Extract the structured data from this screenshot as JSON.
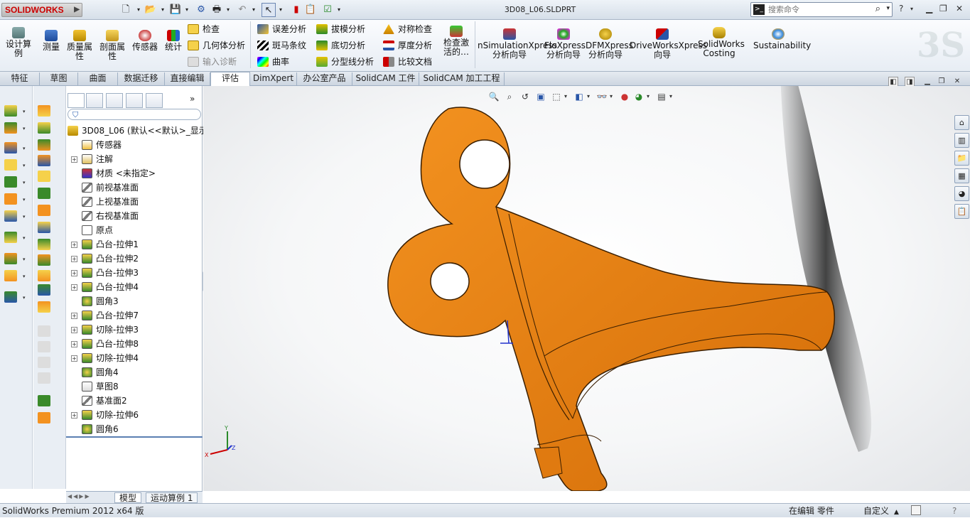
{
  "titlebar": {
    "app_logo": "SOLIDWORKS",
    "document_title": "3D08_L06.SLDPRT",
    "search_placeholder": "搜索命令",
    "help_label": "?"
  },
  "ribbon": {
    "big_buttons": [
      {
        "label": "设计算例",
        "icon": "design-study-icon"
      },
      {
        "label": "测量",
        "icon": "measure-icon"
      },
      {
        "label": "质量属性",
        "icon": "mass-properties-icon"
      },
      {
        "label": "剖面属性",
        "icon": "section-properties-icon"
      },
      {
        "label": "传感器",
        "icon": "sensor-icon"
      },
      {
        "label": "统计",
        "icon": "statistics-icon"
      }
    ],
    "col1": [
      {
        "label": "检查",
        "icon": "check-icon"
      },
      {
        "label": "几何体分析",
        "icon": "geometry-analysis-icon"
      },
      {
        "label": "输入诊断",
        "icon": "import-diagnostics-icon"
      }
    ],
    "col2": [
      {
        "label": "误差分析",
        "icon": "deviation-analysis-icon"
      },
      {
        "label": "斑马条纹",
        "icon": "zebra-stripes-icon"
      },
      {
        "label": "曲率",
        "icon": "curvature-icon"
      }
    ],
    "col3": [
      {
        "label": "拔模分析",
        "icon": "draft-analysis-icon"
      },
      {
        "label": "底切分析",
        "icon": "undercut-analysis-icon"
      },
      {
        "label": "分型线分析",
        "icon": "parting-line-analysis-icon"
      }
    ],
    "col4": [
      {
        "label": "对称检查",
        "icon": "symmetry-check-icon"
      },
      {
        "label": "厚度分析",
        "icon": "thickness-analysis-icon"
      },
      {
        "label": "比较文档",
        "icon": "compare-documents-icon"
      }
    ],
    "check_active": "检查激活的…",
    "xpress": [
      {
        "label": "nSimulationXpress 分析向导",
        "icon": "simulationxpress-icon"
      },
      {
        "label": "FloXpress 分析向导",
        "icon": "floxpress-icon"
      },
      {
        "label": "DFMXpress 分析向导",
        "icon": "dfmxpress-icon"
      },
      {
        "label": "DriveWorksXpress 向导",
        "icon": "driveworksxpress-icon"
      },
      {
        "label": "SolidWorks Costing",
        "icon": "costing-icon"
      },
      {
        "label": "Sustainability",
        "icon": "sustainability-icon"
      }
    ]
  },
  "tabs": [
    "特征",
    "草图",
    "曲面",
    "数据迁移",
    "直接编辑",
    "评估",
    "DimXpert",
    "办公室产品",
    "SolidCAM 工件",
    "SolidCAM 加工工程"
  ],
  "active_tab": "评估",
  "feature_tree": {
    "root": "3D08_L06  (默认<<默认>_显示",
    "items": [
      {
        "label": "传感器",
        "icon": "sensor-folder-icon",
        "expand": false
      },
      {
        "label": "注解",
        "icon": "annotations-icon",
        "expand": true
      },
      {
        "label": "材质 <未指定>",
        "icon": "material-icon",
        "expand": false
      },
      {
        "label": "前视基准面",
        "icon": "plane-icon",
        "expand": false
      },
      {
        "label": "上视基准面",
        "icon": "plane-icon",
        "expand": false
      },
      {
        "label": "右视基准面",
        "icon": "plane-icon",
        "expand": false
      },
      {
        "label": "原点",
        "icon": "origin-icon",
        "expand": false
      },
      {
        "label": "凸台-拉伸1",
        "icon": "boss-extrude-icon",
        "expand": true
      },
      {
        "label": "凸台-拉伸2",
        "icon": "boss-extrude-icon",
        "expand": true
      },
      {
        "label": "凸台-拉伸3",
        "icon": "boss-extrude-icon",
        "expand": true
      },
      {
        "label": "凸台-拉伸4",
        "icon": "boss-extrude-icon",
        "expand": true
      },
      {
        "label": "圆角3",
        "icon": "fillet-icon",
        "expand": false
      },
      {
        "label": "凸台-拉伸7",
        "icon": "boss-extrude-icon",
        "expand": true
      },
      {
        "label": "切除-拉伸3",
        "icon": "cut-extrude-icon",
        "expand": true
      },
      {
        "label": "凸台-拉伸8",
        "icon": "boss-extrude-icon",
        "expand": true
      },
      {
        "label": "切除-拉伸4",
        "icon": "cut-extrude-icon",
        "expand": true
      },
      {
        "label": "圆角4",
        "icon": "fillet-icon",
        "expand": false
      },
      {
        "label": "草图8",
        "icon": "sketch-icon",
        "expand": false
      },
      {
        "label": "基准面2",
        "icon": "plane-icon",
        "expand": false
      },
      {
        "label": "切除-拉伸6",
        "icon": "cut-extrude-icon",
        "expand": true
      },
      {
        "label": "圆角6",
        "icon": "fillet-icon",
        "expand": false
      }
    ]
  },
  "bottom_tabs": [
    "模型",
    "运动算例 1"
  ],
  "triad_labels": {
    "x": "X",
    "y": "Y",
    "z": "Z"
  },
  "statusbar": {
    "left": "SolidWorks Premium 2012 x64 版",
    "mode": "在编辑 零件",
    "units": "自定义"
  },
  "colors": {
    "part": "#e87d10",
    "part_edge": "#3a1e00",
    "accent": "#c00000"
  }
}
